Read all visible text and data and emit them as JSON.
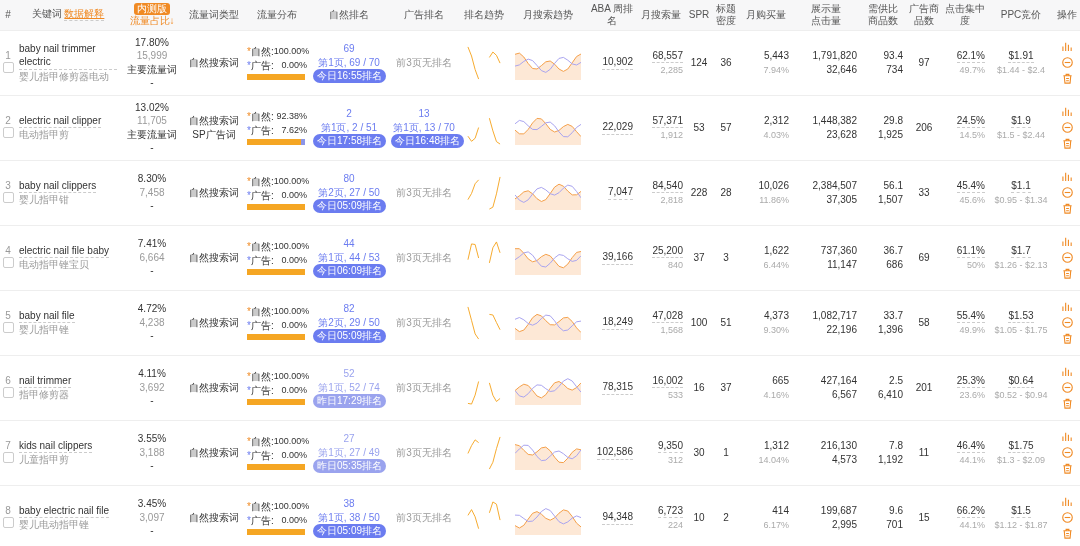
{
  "columns": [
    {
      "label": "#"
    },
    {
      "label": "关键词",
      "link": "数据解释"
    },
    {
      "label": "流量占比↓",
      "badge": "内测版",
      "highlight": true,
      "marker": "*"
    },
    {
      "label": "流量词类型"
    },
    {
      "label": "流量分布"
    },
    {
      "label": "自然排名"
    },
    {
      "label": "广告排名"
    },
    {
      "label": "排名趋势"
    },
    {
      "label": "月搜索趋势"
    },
    {
      "label": "ABA 周排名"
    },
    {
      "label": "月搜索量"
    },
    {
      "label": "SPR"
    },
    {
      "label": "标题密度"
    },
    {
      "label": "月购买量"
    },
    {
      "label": "展示量",
      "label2": "点击量"
    },
    {
      "label": "需供比",
      "label2": "商品数"
    },
    {
      "label": "广告商品数"
    },
    {
      "label": "点击集中度"
    },
    {
      "label": "PPC竞价"
    },
    {
      "label": "操作"
    }
  ],
  "rows": [
    {
      "index": "1",
      "checked": false,
      "keyword": "baby nail trimmer electric",
      "translation": "婴儿指甲修剪器电动",
      "share": "17.80%",
      "share_count": "15,999",
      "tag": "主要流量词",
      "dash": "-",
      "types": [
        "自然搜索词"
      ],
      "natural_label": "自然:",
      "natural": "100.00%",
      "ad_label": "广告:",
      "ad": "0.00%",
      "level": 1,
      "natural_rank": {
        "rank": "69",
        "page": "第1页, 69 / 70",
        "time": "今日16:55排名",
        "stale": false
      },
      "ad_rank": {
        "none": "前3页无排名"
      },
      "aba": "10,902",
      "search": "68,557",
      "search_sub": "2,285",
      "spr": "124",
      "title_density": "36",
      "purchases": "5,443",
      "purchase_rate": "7.94%",
      "impressions": "1,791,820",
      "clicks": "32,646",
      "ratio": "93.4",
      "products": "734",
      "ad_products": "97",
      "click_share": "62.1%",
      "click_share_sub": "49.7%",
      "ppc": "$1.91",
      "ppc_range": "$1.44 - $2.4"
    },
    {
      "index": "2",
      "checked": false,
      "keyword": "electric nail clipper",
      "translation": "电动指甲剪",
      "share": "13.02%",
      "share_count": "11,705",
      "tag": "主要流量词",
      "dash": "-",
      "types": [
        "自然搜索词",
        "SP广告词"
      ],
      "natural_label": "自然:",
      "natural": "92.38%",
      "ad_label": "广告:",
      "ad": "7.62%",
      "level": 0.9238,
      "natural_rank": {
        "rank": "2",
        "page": "第1页, 2 / 51",
        "time": "今日17:58排名",
        "stale": false
      },
      "ad_rank": {
        "rank": "13",
        "page": "第1页, 13 / 70",
        "time": "今日16:48排名",
        "stale": false
      },
      "aba": "22,029",
      "search": "57,371",
      "search_sub": "1,912",
      "spr": "53",
      "title_density": "57",
      "purchases": "2,312",
      "purchase_rate": "4.03%",
      "impressions": "1,448,382",
      "clicks": "23,628",
      "ratio": "29.8",
      "products": "1,925",
      "ad_products": "206",
      "click_share": "24.5%",
      "click_share_sub": "14.5%",
      "ppc": "$1.9",
      "ppc_range": "$1.5 - $2.44"
    },
    {
      "index": "3",
      "checked": false,
      "keyword": "baby nail clippers",
      "translation": "婴儿指甲钳",
      "share": "8.30%",
      "share_count": "7,458",
      "dash": "-",
      "types": [
        "自然搜索词"
      ],
      "natural_label": "自然:",
      "natural": "100.00%",
      "ad_label": "广告:",
      "ad": "0.00%",
      "level": 1,
      "natural_rank": {
        "rank": "80",
        "page": "第2页, 27 / 50",
        "time": "今日05:09排名",
        "stale": false
      },
      "ad_rank": {
        "none": "前3页无排名"
      },
      "aba": "7,047",
      "search": "84,540",
      "search_sub": "2,818",
      "spr": "228",
      "title_density": "28",
      "purchases": "10,026",
      "purchase_rate": "11.86%",
      "impressions": "2,384,507",
      "clicks": "37,305",
      "ratio": "56.1",
      "products": "1,507",
      "ad_products": "33",
      "click_share": "45.4%",
      "click_share_sub": "45.6%",
      "ppc": "$1.1",
      "ppc_range": "$0.95 - $1.34"
    },
    {
      "index": "4",
      "checked": false,
      "keyword": "electric nail file baby",
      "translation": "电动指甲锉宝贝",
      "share": "7.41%",
      "share_count": "6,664",
      "dash": "-",
      "types": [
        "自然搜索词"
      ],
      "natural_label": "自然:",
      "natural": "100.00%",
      "ad_label": "广告:",
      "ad": "0.00%",
      "level": 1,
      "natural_rank": {
        "rank": "44",
        "page": "第1页, 44 / 53",
        "time": "今日06:09排名",
        "stale": false
      },
      "ad_rank": {
        "none": "前3页无排名"
      },
      "aba": "39,166",
      "search": "25,200",
      "search_sub": "840",
      "spr": "37",
      "title_density": "3",
      "purchases": "1,622",
      "purchase_rate": "6.44%",
      "impressions": "737,360",
      "clicks": "11,147",
      "ratio": "36.7",
      "products": "686",
      "ad_products": "69",
      "click_share": "61.1%",
      "click_share_sub": "50%",
      "ppc": "$1.7",
      "ppc_range": "$1.26 - $2.13"
    },
    {
      "index": "5",
      "checked": false,
      "keyword": "baby nail file",
      "translation": "婴儿指甲锉",
      "share": "4.72%",
      "share_count": "4,238",
      "dash": "-",
      "types": [
        "自然搜索词"
      ],
      "natural_label": "自然:",
      "natural": "100.00%",
      "ad_label": "广告:",
      "ad": "0.00%",
      "level": 1,
      "natural_rank": {
        "rank": "82",
        "page": "第2页, 29 / 50",
        "time": "今日05:09排名",
        "stale": false
      },
      "ad_rank": {
        "none": "前3页无排名"
      },
      "aba": "18,249",
      "search": "47,028",
      "search_sub": "1,568",
      "spr": "100",
      "title_density": "51",
      "purchases": "4,373",
      "purchase_rate": "9.30%",
      "impressions": "1,082,717",
      "clicks": "22,196",
      "ratio": "33.7",
      "products": "1,396",
      "ad_products": "58",
      "click_share": "55.4%",
      "click_share_sub": "49.9%",
      "ppc": "$1.53",
      "ppc_range": "$1.05 - $1.75"
    },
    {
      "index": "6",
      "checked": false,
      "keyword": "nail trimmer",
      "translation": "指甲修剪器",
      "share": "4.11%",
      "share_count": "3,692",
      "dash": "-",
      "types": [
        "自然搜索词"
      ],
      "natural_label": "自然:",
      "natural": "100.00%",
      "ad_label": "广告:",
      "ad": "0.00%",
      "level": 1,
      "natural_rank": {
        "rank": "52",
        "page": "第1页, 52 / 74",
        "time": "昨日17:29排名",
        "stale": true
      },
      "ad_rank": {
        "none": "前3页无排名"
      },
      "aba": "78,315",
      "search": "16,002",
      "search_sub": "533",
      "spr": "16",
      "title_density": "37",
      "purchases": "665",
      "purchase_rate": "4.16%",
      "impressions": "427,164",
      "clicks": "6,567",
      "ratio": "2.5",
      "products": "6,410",
      "ad_products": "201",
      "click_share": "25.3%",
      "click_share_sub": "23.6%",
      "ppc": "$0.64",
      "ppc_range": "$0.52 - $0.94"
    },
    {
      "index": "7",
      "checked": false,
      "keyword": "kids nail clippers",
      "translation": "儿童指甲剪",
      "share": "3.55%",
      "share_count": "3,188",
      "dash": "-",
      "types": [
        "自然搜索词"
      ],
      "natural_label": "自然:",
      "natural": "100.00%",
      "ad_label": "广告:",
      "ad": "0.00%",
      "level": 1,
      "natural_rank": {
        "rank": "27",
        "page": "第1页, 27 / 49",
        "time": "昨日05:35排名",
        "stale": true
      },
      "ad_rank": {
        "none": "前3页无排名"
      },
      "aba": "102,586",
      "search": "9,350",
      "search_sub": "312",
      "spr": "30",
      "title_density": "1",
      "purchases": "1,312",
      "purchase_rate": "14.04%",
      "impressions": "216,130",
      "clicks": "4,573",
      "ratio": "7.8",
      "products": "1,192",
      "ad_products": "11",
      "click_share": "46.4%",
      "click_share_sub": "44.1%",
      "ppc": "$1.75",
      "ppc_range": "$1.3 - $2.09"
    },
    {
      "index": "8",
      "checked": false,
      "keyword": "baby electric nail file",
      "translation": "婴儿电动指甲锉",
      "share": "3.45%",
      "share_count": "3,097",
      "dash": "-",
      "types": [
        "自然搜索词"
      ],
      "natural_label": "自然:",
      "natural": "100.00%",
      "ad_label": "广告:",
      "ad": "0.00%",
      "level": 1,
      "natural_rank": {
        "rank": "38",
        "page": "第1页, 38 / 50",
        "time": "今日05:09排名",
        "stale": false
      },
      "ad_rank": {
        "none": "前3页无排名"
      },
      "aba": "94,348",
      "search": "6,723",
      "search_sub": "224",
      "spr": "10",
      "title_density": "2",
      "purchases": "414",
      "purchase_rate": "6.17%",
      "impressions": "199,687",
      "clicks": "2,995",
      "ratio": "9.6",
      "products": "701",
      "ad_products": "15",
      "click_share": "66.2%",
      "click_share_sub": "44.1%",
      "ppc": "$1.5",
      "ppc_range": "$1.12 - $1.87"
    }
  ]
}
